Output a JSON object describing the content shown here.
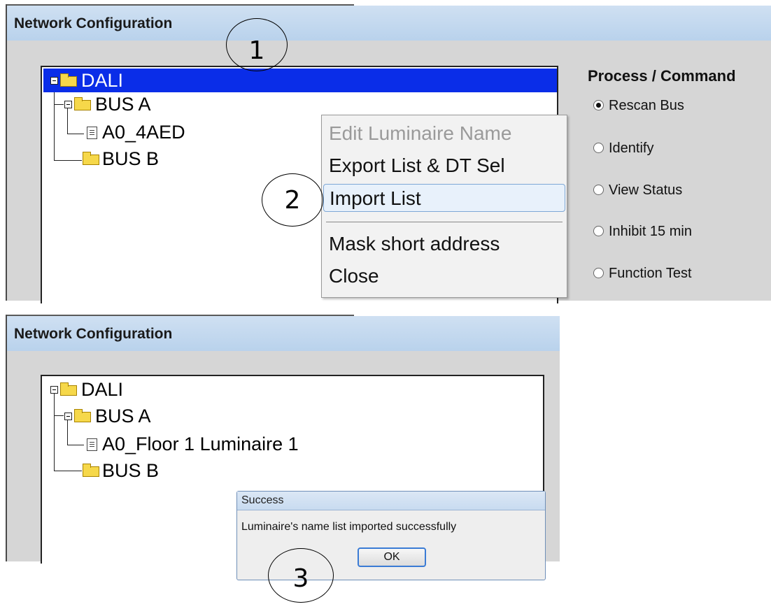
{
  "top_panel": {
    "title": "Network Configuration",
    "tree": {
      "root": "DALI",
      "bus_a": "BUS A",
      "device": "A0_4AED",
      "bus_b": "BUS B"
    },
    "commands": {
      "title": "Process / Command",
      "options": [
        "Rescan Bus",
        "Identify",
        "View Status",
        "Inhibit 15 min",
        "Function Test"
      ],
      "selected": "Rescan Bus"
    },
    "context_menu": {
      "items": [
        "Edit Luminaire Name",
        "Export List & DT Sel",
        "Import List",
        "Mask short address",
        "Close"
      ],
      "disabled": "Edit Luminaire Name",
      "highlighted": "Import List"
    }
  },
  "bottom_panel": {
    "title": "Network Configuration",
    "tree": {
      "root": "DALI",
      "bus_a": "BUS A",
      "device": "A0_Floor 1 Luminaire 1",
      "bus_b": "BUS B"
    },
    "dialog": {
      "title": "Success",
      "message": "Luminaire's name list imported successfully",
      "ok_label": "OK"
    }
  },
  "callouts": [
    "1",
    "2",
    "3"
  ]
}
